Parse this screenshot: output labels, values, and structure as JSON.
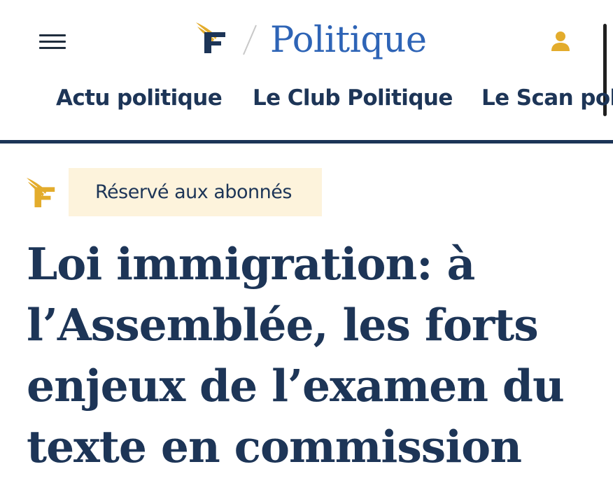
{
  "header": {
    "menu_icon": "hamburger-menu-icon",
    "logo_icon": "le-figaro-logo-icon",
    "section_title": "Politique",
    "account_icon": "user-account-icon",
    "subnav": [
      {
        "label": "Actu politique"
      },
      {
        "label": "Le Club Politique"
      },
      {
        "label": "Le Scan poli"
      }
    ]
  },
  "article": {
    "badge_icon": "le-figaro-logo-icon",
    "badge_label": "Réservé aux abonnés",
    "headline": "Loi immigration: à l’Assemblée, les forts enjeux de l’examen du texte en commission"
  },
  "colors": {
    "navy": "#1d3557",
    "section_blue": "#2e64b6",
    "gold": "#e3ac2c",
    "badge_background": "#fdf3dc"
  }
}
